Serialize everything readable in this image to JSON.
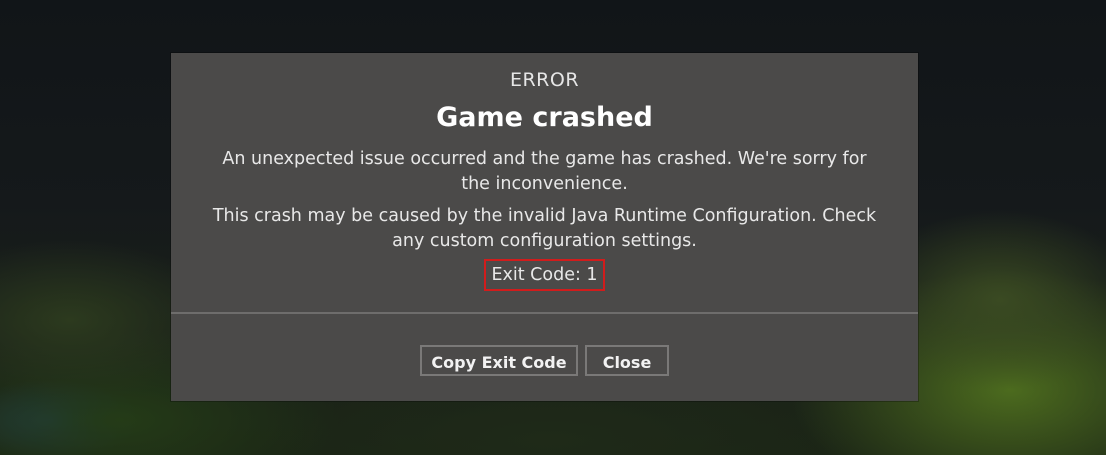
{
  "dialog": {
    "kicker": "ERROR",
    "title": "Game crashed",
    "message_1": "An unexpected issue occurred and the game has crashed. We're sorry for the inconvenience.",
    "message_2": "This crash may be caused by the invalid Java Runtime Configuration. Check any custom configuration settings.",
    "exit_code": "Exit Code: 1",
    "buttons": {
      "copy_exit_code": "Copy Exit Code",
      "close": "Close"
    }
  },
  "colors": {
    "dialog_background": "#4b4a49",
    "highlight_border": "#d11c1c",
    "text": "#e8e8e8"
  }
}
